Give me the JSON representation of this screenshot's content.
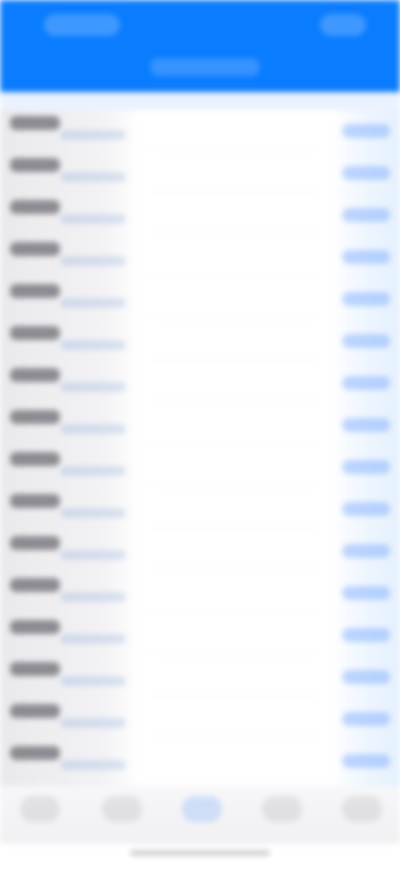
{
  "header": {
    "left_button_label": "",
    "title": "",
    "right_button_label": ""
  },
  "section": {
    "label": ""
  },
  "list": {
    "rows": [
      {
        "title": "",
        "subtitle": "",
        "value": ""
      },
      {
        "title": "",
        "subtitle": "",
        "value": ""
      },
      {
        "title": "",
        "subtitle": "",
        "value": ""
      },
      {
        "title": "",
        "subtitle": "",
        "value": ""
      },
      {
        "title": "",
        "subtitle": "",
        "value": ""
      },
      {
        "title": "",
        "subtitle": "",
        "value": ""
      },
      {
        "title": "",
        "subtitle": "",
        "value": ""
      },
      {
        "title": "",
        "subtitle": "",
        "value": ""
      },
      {
        "title": "",
        "subtitle": "",
        "value": ""
      },
      {
        "title": "",
        "subtitle": "",
        "value": ""
      },
      {
        "title": "",
        "subtitle": "",
        "value": ""
      },
      {
        "title": "",
        "subtitle": "",
        "value": ""
      },
      {
        "title": "",
        "subtitle": "",
        "value": ""
      },
      {
        "title": "",
        "subtitle": "",
        "value": ""
      },
      {
        "title": "",
        "subtitle": "",
        "value": ""
      },
      {
        "title": "",
        "subtitle": "",
        "value": ""
      }
    ]
  },
  "bottom_nav": {
    "items": [
      {
        "label": ""
      },
      {
        "label": ""
      },
      {
        "label": ""
      },
      {
        "label": ""
      },
      {
        "label": ""
      }
    ],
    "active_index": 2
  },
  "colors": {
    "header_bg": "#0a7cff",
    "accent": "#0a7cff"
  }
}
